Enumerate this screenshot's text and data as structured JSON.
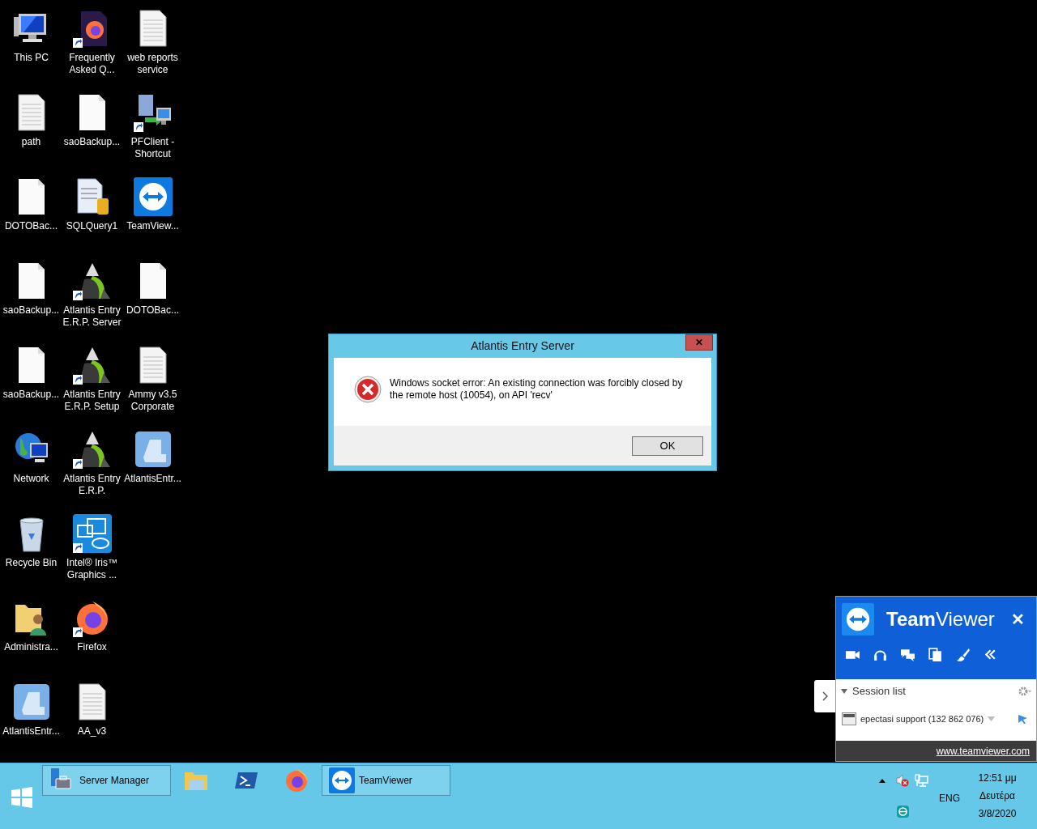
{
  "desktop_icons": [
    [
      {
        "label": "This PC",
        "kind": "computer",
        "shortcut": false
      },
      {
        "label": "Frequently Asked Q...",
        "kind": "firefox-file",
        "shortcut": true
      },
      {
        "label": "web reports service",
        "kind": "text-file",
        "shortcut": false
      }
    ],
    [
      {
        "label": "path",
        "kind": "text-file",
        "shortcut": false
      },
      {
        "label": "saoBackup...",
        "kind": "blank-file",
        "shortcut": false
      },
      {
        "label": "PFClient - Shortcut",
        "kind": "server-monitor",
        "shortcut": true
      }
    ],
    [
      {
        "label": "DOTOBac...",
        "kind": "blank-file",
        "shortcut": false
      },
      {
        "label": "SQLQuery1",
        "kind": "sql-file",
        "shortcut": false
      },
      {
        "label": "TeamView...",
        "kind": "teamviewer",
        "shortcut": false
      }
    ],
    [
      {
        "label": "saoBackup...",
        "kind": "blank-file",
        "shortcut": false
      },
      {
        "label": "Atlantis Entry E.R.P. Server",
        "kind": "atlantis",
        "shortcut": true
      },
      {
        "label": "DOTOBac...",
        "kind": "blank-file",
        "shortcut": false
      }
    ],
    [
      {
        "label": "saoBackup...",
        "kind": "blank-file",
        "shortcut": false
      },
      {
        "label": "Atlantis Entry E.R.P. Setup",
        "kind": "atlantis",
        "shortcut": true
      },
      {
        "label": "Ammy v3.5 Corporate",
        "kind": "text-file",
        "shortcut": false
      }
    ],
    [
      {
        "label": "Network",
        "kind": "network",
        "shortcut": false
      },
      {
        "label": "Atlantis Entry E.R.P.",
        "kind": "atlantis",
        "shortcut": true
      },
      {
        "label": "AtlantisEntr...",
        "kind": "atlantis-app",
        "shortcut": false
      }
    ],
    [
      {
        "label": "Recycle Bin",
        "kind": "recycle",
        "shortcut": false
      },
      {
        "label": "Intel® Iris™ Graphics ...",
        "kind": "intel",
        "shortcut": true
      }
    ],
    [
      {
        "label": "Administra...",
        "kind": "user-folder",
        "shortcut": false
      },
      {
        "label": "Firefox",
        "kind": "firefox",
        "shortcut": true
      }
    ],
    [
      {
        "label": "AtlantisEntr...",
        "kind": "atlantis-app",
        "shortcut": false
      },
      {
        "label": "AA_v3",
        "kind": "text-file",
        "shortcut": false
      }
    ]
  ],
  "dialog": {
    "title": "Atlantis Entry Server",
    "close": "✕",
    "message": "Windows socket error: An existing connection was forcibly closed by the remote host (10054), on API 'recv'",
    "buttons": [
      "OK"
    ]
  },
  "teamviewer_panel": {
    "title": "**Team**Viewer",
    "close": "✕",
    "session_list": {
      "label": "Session list",
      "expanded": true,
      "sessions": [
        {
          "name": "epectasi support (132 862 076)"
        }
      ]
    },
    "link": "www.teamviewer.com"
  },
  "taskbar": {
    "items": [
      {
        "kind": "server-manager",
        "label": "Server Manager",
        "open": true
      },
      {
        "kind": "explorer",
        "open": false
      },
      {
        "kind": "powershell",
        "open": false
      },
      {
        "kind": "firefox",
        "open": false
      },
      {
        "kind": "teamviewer",
        "label": "TeamViewer",
        "open": true
      }
    ],
    "tray": {
      "language": "ENG",
      "time": "12:51 μμ",
      "day": "Δευτέρα",
      "date": "3/8/2020"
    }
  }
}
